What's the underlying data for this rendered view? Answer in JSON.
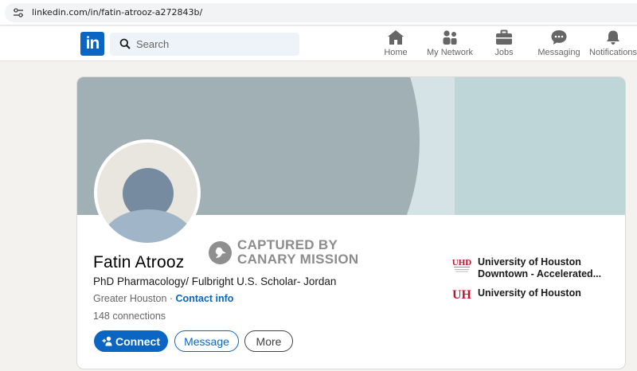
{
  "browser": {
    "url": "linkedin.com/in/fatin-atrooz-a272843b/"
  },
  "nav": {
    "logo": "in",
    "search_placeholder": "Search",
    "items": [
      {
        "label": "Home",
        "icon": "home-icon"
      },
      {
        "label": "My Network",
        "icon": "network-icon"
      },
      {
        "label": "Jobs",
        "icon": "briefcase-icon"
      },
      {
        "label": "Messaging",
        "icon": "messaging-icon"
      },
      {
        "label": "Notifications",
        "icon": "bell-icon"
      }
    ]
  },
  "profile": {
    "name": "Fatin Atrooz",
    "headline": "PhD Pharmacology/ Fulbright U.S. Scholar- Jordan",
    "location": "Greater Houston",
    "separator": " · ",
    "contact_info": "Contact info",
    "connections": "148 connections",
    "buttons": {
      "connect": "Connect",
      "message": "Message",
      "more": "More"
    },
    "education": [
      {
        "name_line1": "University of Houston",
        "name_line2": "Downtown - Accelerated...",
        "logo": "uhd-logo"
      },
      {
        "name_line1": "University of Houston",
        "name_line2": "",
        "logo": "uh-logo"
      }
    ]
  },
  "watermark": {
    "line1": "CAPTURED BY",
    "line2": "CANARY MISSION"
  },
  "colors": {
    "accent": "#0a66c2",
    "uh_red": "#c8102e",
    "page_bg": "#f4f2ee"
  }
}
